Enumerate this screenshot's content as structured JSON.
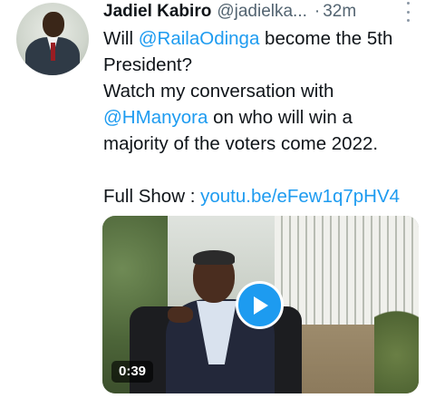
{
  "tweet": {
    "author_name": "Jadiel Kabiro",
    "handle": "@jadielka...",
    "separator": "·",
    "time": "32m",
    "text_lines": [
      [
        {
          "t": "Will ",
          "link": false
        },
        {
          "t": "@RailaOdinga",
          "link": true
        },
        {
          "t": " become the 5th",
          "link": false
        }
      ],
      [
        {
          "t": "President?",
          "link": false
        }
      ],
      [
        {
          "t": "Watch my conversation with",
          "link": false
        }
      ],
      [
        {
          "t": "@HManyora",
          "link": true
        },
        {
          "t": " on who will win a",
          "link": false
        }
      ],
      [
        {
          "t": "majority of the voters come 2022.",
          "link": false
        }
      ],
      [],
      [
        {
          "t": "Full Show : ",
          "link": false
        },
        {
          "t": "youtu.be/eFew1q7pHV4",
          "link": true
        }
      ]
    ],
    "video": {
      "duration": "0:39",
      "play_icon": "play-icon"
    },
    "more_icon": "more-vertical-icon"
  },
  "colors": {
    "link": "#1d9bf0",
    "text": "#0f1419",
    "secondary": "#536471",
    "play_button": "#1d9bf0"
  }
}
